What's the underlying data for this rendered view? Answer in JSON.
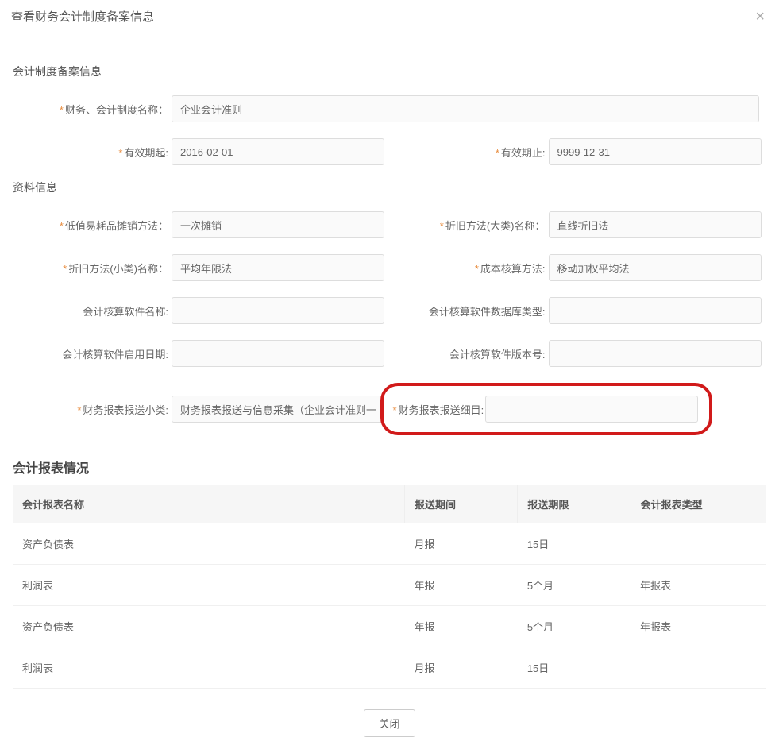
{
  "header": {
    "title": "查看财务会计制度备案信息"
  },
  "section1": {
    "title": "会计制度备案信息",
    "fields": {
      "systemName": {
        "label": "财务、会计制度名称：",
        "value": "企业会计准则"
      },
      "validFrom": {
        "label": "有效期起:",
        "value": "2016-02-01"
      },
      "validTo": {
        "label": "有效期止:",
        "value": "9999-12-31"
      }
    }
  },
  "section2": {
    "title": "资料信息",
    "fields": {
      "lowValueMethod": {
        "label": "低值易耗品摊销方法：",
        "value": "一次摊销"
      },
      "deprMajor": {
        "label": "折旧方法(大类)名称：",
        "value": "直线折旧法"
      },
      "deprMinor": {
        "label": "折旧方法(小类)名称：",
        "value": "平均年限法"
      },
      "costMethod": {
        "label": "成本核算方法:",
        "value": "移动加权平均法"
      },
      "softwareName": {
        "label": "会计核算软件名称:",
        "value": ""
      },
      "dbType": {
        "label": "会计核算软件数据库类型:",
        "value": ""
      },
      "enableDate": {
        "label": "会计核算软件启用日期:",
        "value": ""
      },
      "version": {
        "label": "会计核算软件版本号:",
        "value": ""
      },
      "reportSubcat": {
        "label": "财务报表报送小类:",
        "value": "财务报表报送与信息采集（企业会计准则一般企业"
      },
      "reportDetail": {
        "label": "财务报表报送细目:",
        "value": ""
      }
    }
  },
  "table": {
    "title": "会计报表情况",
    "headers": {
      "name": "会计报表名称",
      "period": "报送期间",
      "deadline": "报送期限",
      "type": "会计报表类型"
    },
    "rows": [
      {
        "name": "资产负债表",
        "period": "月报",
        "deadline": "15日",
        "type": ""
      },
      {
        "name": "利润表",
        "period": "年报",
        "deadline": "5个月",
        "type": "年报表"
      },
      {
        "name": "资产负债表",
        "period": "年报",
        "deadline": "5个月",
        "type": "年报表"
      },
      {
        "name": "利润表",
        "period": "月报",
        "deadline": "15日",
        "type": ""
      }
    ]
  },
  "footer": {
    "closeLabel": "关闭"
  }
}
